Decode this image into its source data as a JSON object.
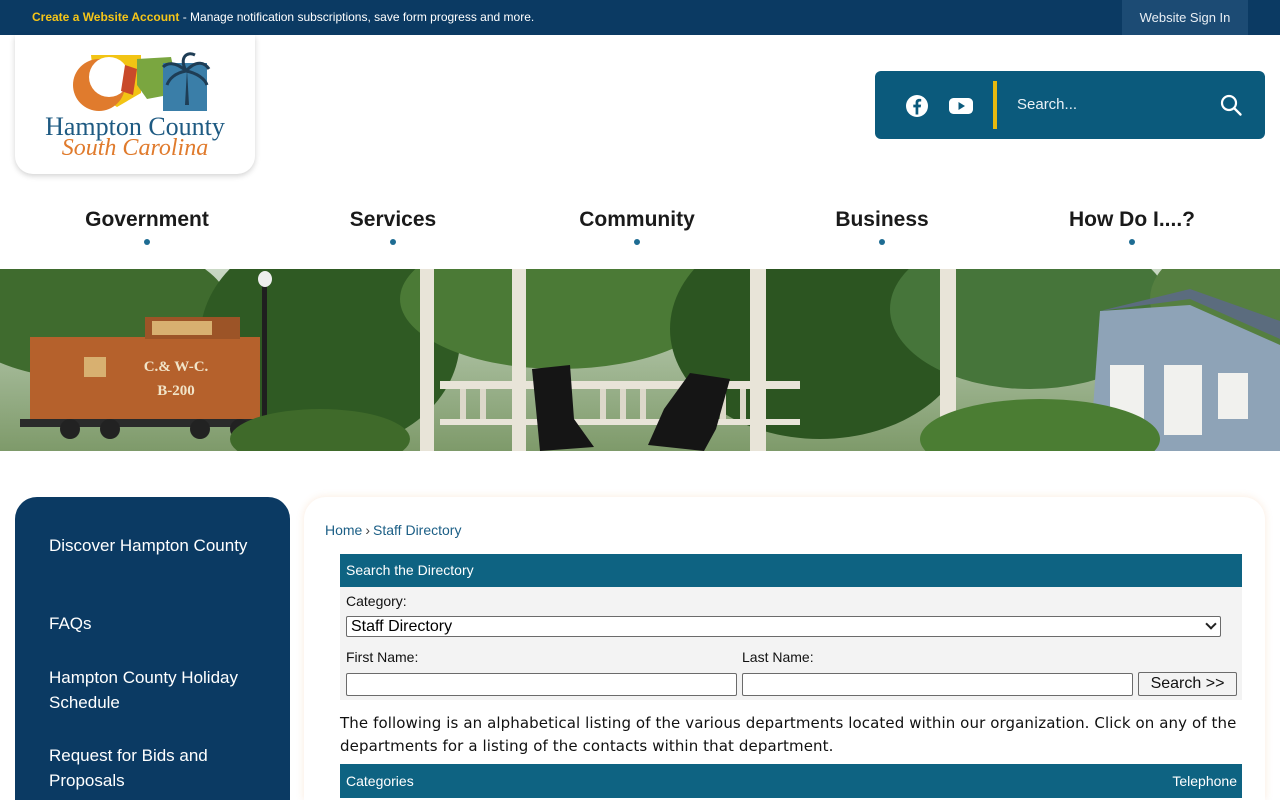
{
  "topbar": {
    "create_account_link": "Create a Website Account",
    "create_account_desc": " - Manage notification subscriptions, save form progress and more.",
    "sign_in": "Website Sign In"
  },
  "logo": {
    "line1": "Hampton County",
    "line2": "South Carolina"
  },
  "search": {
    "placeholder": "Search..."
  },
  "nav": {
    "items": [
      {
        "label": "Government"
      },
      {
        "label": "Services"
      },
      {
        "label": "Community"
      },
      {
        "label": "Business"
      },
      {
        "label": "How Do I....?"
      }
    ]
  },
  "banner": {
    "caboose_line1": "C.& W-C.",
    "caboose_line2": "B-200"
  },
  "sidebar": {
    "items": [
      {
        "label": "Discover Hampton County"
      },
      {
        "label": "FAQs"
      },
      {
        "label": "Hampton County Holiday Schedule"
      },
      {
        "label": "Request for Bids and Proposals"
      }
    ]
  },
  "breadcrumb": {
    "home": "Home",
    "separator": "›",
    "current": "Staff Directory"
  },
  "directory": {
    "title": "Search the Directory",
    "category_label": "Category:",
    "category_value": "Staff Directory",
    "first_name_label": "First Name:",
    "last_name_label": "Last Name:",
    "search_button": "Search >>",
    "intro": "The following is an alphabetical listing of the various departments located within our organization. Click on any of the departments for a listing of the contacts within that department.",
    "table_headers": {
      "categories": "Categories",
      "telephone": "Telephone"
    }
  },
  "colors": {
    "topbar": "#0b3a63",
    "accent_yellow": "#f5c518",
    "search_panel": "#0b5a7c",
    "table_header": "#0e6382",
    "sidebar": "#0b3a63"
  }
}
